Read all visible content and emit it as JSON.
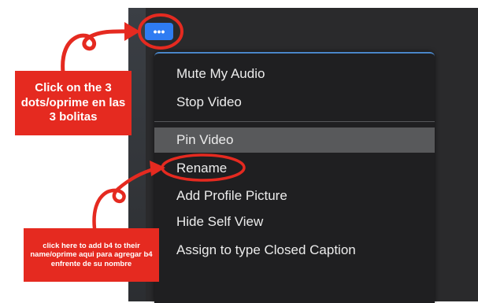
{
  "toolbar": {
    "more_button_label": "•••"
  },
  "menu": {
    "items": [
      {
        "label": "Mute My Audio"
      },
      {
        "label": "Stop Video"
      },
      {
        "label": "Pin Video"
      },
      {
        "label": "Rename"
      },
      {
        "label": "Add Profile Picture"
      },
      {
        "label": "Hide Self View"
      },
      {
        "label": "Assign to type Closed Caption"
      }
    ]
  },
  "annotations": {
    "top_label": "Click on the 3 dots/oprime en las 3 bolitas",
    "bottom_label": "click here to add b4 to their name/oprime aqui para agregar b4 enfrente de su nombre"
  },
  "colors": {
    "annotation_red": "#e52a20",
    "button_blue": "#2f7cf2",
    "menu_bg": "#1f1f21",
    "highlight": "#58595b"
  }
}
